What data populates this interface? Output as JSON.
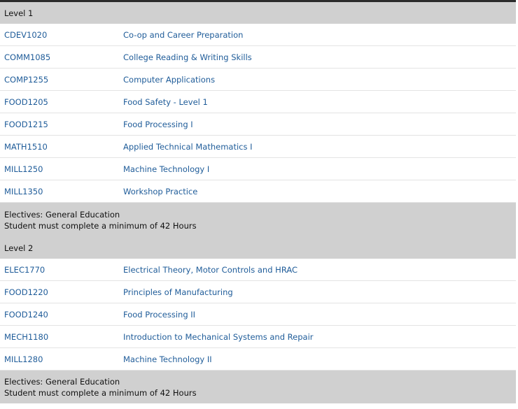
{
  "levels": [
    {
      "label": "Level 1",
      "courses": [
        {
          "code": "CDEV1020",
          "title": "Co-op and Career Preparation"
        },
        {
          "code": "COMM1085",
          "title": "College Reading & Writing Skills"
        },
        {
          "code": "COMP1255",
          "title": "Computer Applications"
        },
        {
          "code": "FOOD1205",
          "title": "Food Safety - Level 1"
        },
        {
          "code": "FOOD1215",
          "title": "Food Processing I"
        },
        {
          "code": "MATH1510",
          "title": "Applied Technical Mathematics I"
        },
        {
          "code": "MILL1250",
          "title": "Machine Technology I"
        },
        {
          "code": "MILL1350",
          "title": "Workshop Practice"
        }
      ],
      "electives": {
        "title": "Electives: General Education",
        "requirement": "Student must complete a minimum of 42 Hours"
      }
    },
    {
      "label": "Level 2",
      "courses": [
        {
          "code": "ELEC1770",
          "title": "Electrical Theory, Motor Controls and HRAC"
        },
        {
          "code": "FOOD1220",
          "title": "Principles of Manufacturing"
        },
        {
          "code": "FOOD1240",
          "title": "Food Processing II"
        },
        {
          "code": "MECH1180",
          "title": "Introduction to Mechanical Systems and Repair"
        },
        {
          "code": "MILL1280",
          "title": "Machine Technology II"
        }
      ],
      "electives": {
        "title": "Electives: General Education",
        "requirement": "Student must complete a minimum of 42 Hours"
      }
    }
  ]
}
